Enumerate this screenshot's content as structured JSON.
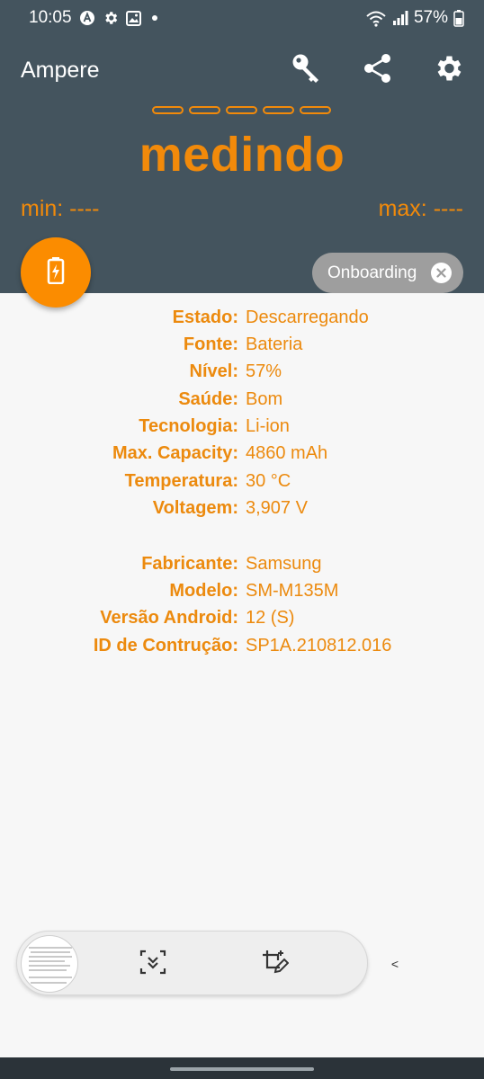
{
  "status_bar": {
    "time": "10:05",
    "battery": "57%",
    "icons": [
      "a-circle-icon",
      "gear-icon",
      "image-icon",
      "dot-icon",
      "wifi-icon",
      "signal-icon",
      "battery-icon"
    ]
  },
  "header": {
    "title": "Ampere",
    "toolbar": [
      "key-icon",
      "share-icon",
      "gear-icon"
    ],
    "reading": "medindo",
    "min": "min: ----",
    "max": "max: ----"
  },
  "fab": {
    "icon": "battery-charging-icon"
  },
  "onboarding": {
    "label": "Onboarding",
    "close_icon": "close-circle-icon"
  },
  "battery_info": [
    {
      "label": "Estado:",
      "value": "Descarregando"
    },
    {
      "label": "Fonte:",
      "value": "Bateria"
    },
    {
      "label": "Nível:",
      "value": "57%"
    },
    {
      "label": "Saúde:",
      "value": "Bom"
    },
    {
      "label": "Tecnologia:",
      "value": "Li-ion"
    },
    {
      "label": "Max. Capacity:",
      "value": "4860 mAh"
    },
    {
      "label": "Temperatura:",
      "value": "30 °C"
    },
    {
      "label": "Voltagem:",
      "value": "3,907 V"
    }
  ],
  "device_info": [
    {
      "label": "Fabricante:",
      "value": "Samsung"
    },
    {
      "label": "Modelo:",
      "value": "SM-M135M"
    },
    {
      "label": "Versão Android:",
      "value": "12 (S)"
    },
    {
      "label": "ID de Contrução:",
      "value": "SP1A.210812.016"
    }
  ],
  "screenshot_toolbar": {
    "collapse": "<",
    "buttons": [
      "scroll-capture-icon",
      "crop-edit-icon"
    ]
  },
  "colors": {
    "header_bg": "#44545e",
    "accent": "#f28a0a",
    "fab": "#fb8c00",
    "chip": "#9e9e9e",
    "background": "#f7f7f7"
  }
}
